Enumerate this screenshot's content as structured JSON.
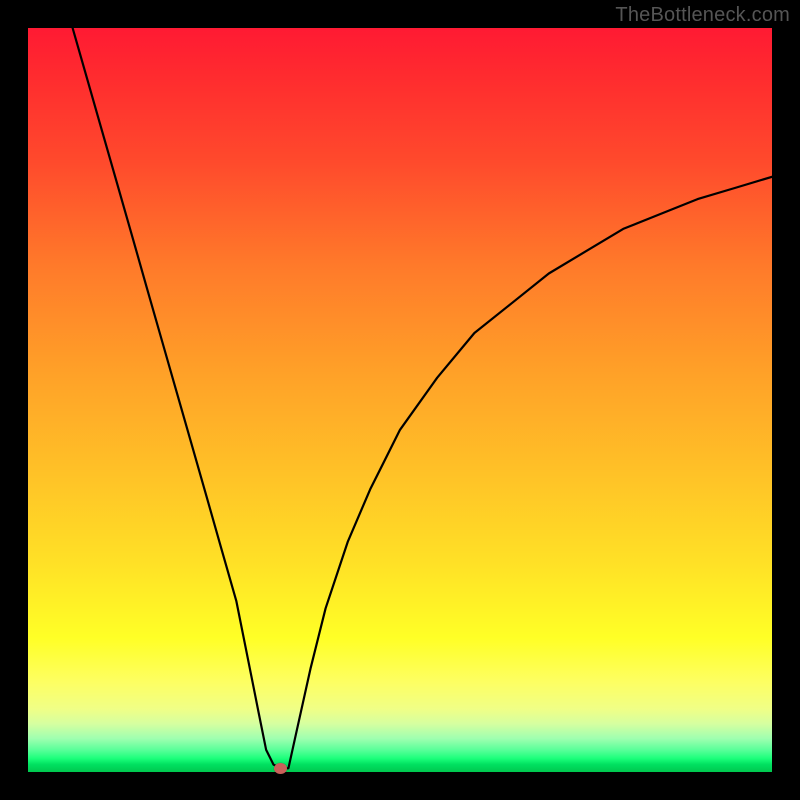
{
  "watermark": "TheBottleneck.com",
  "chart_data": {
    "type": "line",
    "title": "",
    "xlabel": "",
    "ylabel": "",
    "xlim": [
      0,
      100
    ],
    "ylim": [
      0,
      100
    ],
    "grid": false,
    "series": [
      {
        "name": "curve",
        "x": [
          6,
          8,
          10,
          12,
          14,
          16,
          18,
          20,
          22,
          24,
          26,
          28,
          30,
          31,
          32,
          33,
          34,
          35,
          36,
          38,
          40,
          43,
          46,
          50,
          55,
          60,
          65,
          70,
          75,
          80,
          85,
          90,
          95,
          100
        ],
        "values": [
          100,
          93,
          86,
          79,
          72,
          65,
          58,
          51,
          44,
          37,
          30,
          23,
          13,
          8,
          3,
          1,
          0.5,
          0.5,
          5,
          14,
          22,
          31,
          38,
          46,
          53,
          59,
          63,
          67,
          70,
          73,
          75,
          77,
          78.5,
          80
        ]
      }
    ],
    "marker": {
      "x": 34,
      "y": 0.5,
      "color": "#c9605a"
    },
    "background": {
      "type": "vertical-gradient",
      "stops": [
        {
          "pos": 0,
          "color": "#ff1a33"
        },
        {
          "pos": 46,
          "color": "#ffa028"
        },
        {
          "pos": 82,
          "color": "#ffff26"
        },
        {
          "pos": 99,
          "color": "#00e060"
        }
      ]
    }
  }
}
